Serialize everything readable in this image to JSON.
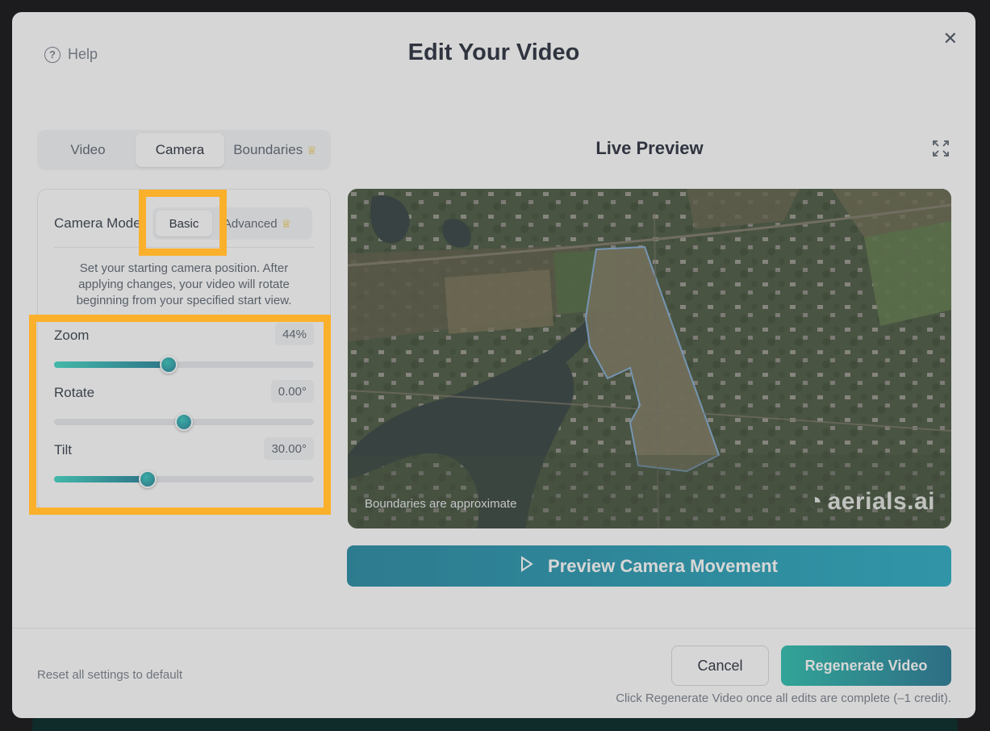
{
  "modal": {
    "title": "Edit Your Video",
    "help_label": "Help",
    "close_glyph": "✕"
  },
  "tabs": [
    {
      "label": "Video"
    },
    {
      "label": "Camera",
      "active": true
    },
    {
      "label": "Boundaries",
      "premium_icon": "crown-icon"
    }
  ],
  "camera": {
    "mode_label": "Camera Mode",
    "modes": [
      {
        "label": "Basic",
        "active": true
      },
      {
        "label": "Advanced",
        "premium_icon": "crown-icon"
      }
    ],
    "description": "Set your starting camera position. After applying changes, your video will rotate beginning from your specified start view.",
    "sliders": [
      {
        "label": "Zoom",
        "value_text": "44%",
        "fraction": 0.44
      },
      {
        "label": "Rotate",
        "value_text": "0.00°",
        "fraction": 0.5
      },
      {
        "label": "Tilt",
        "value_text": "30.00°",
        "fraction": 0.36
      }
    ]
  },
  "preview": {
    "title": "Live Preview",
    "map_note": "Boundaries are approximate",
    "watermark": "aerials.ai",
    "button_label": "Preview Camera Movement"
  },
  "footer": {
    "reset_label": "Reset all settings to default",
    "cancel_label": "Cancel",
    "regenerate_label": "Regenerate Video",
    "hint": "Click Regenerate Video once all edits are complete (–1 credit)."
  },
  "colors": {
    "accent": "#0e7d99",
    "highlight": "#fbb02c",
    "crown": "#eab308"
  }
}
